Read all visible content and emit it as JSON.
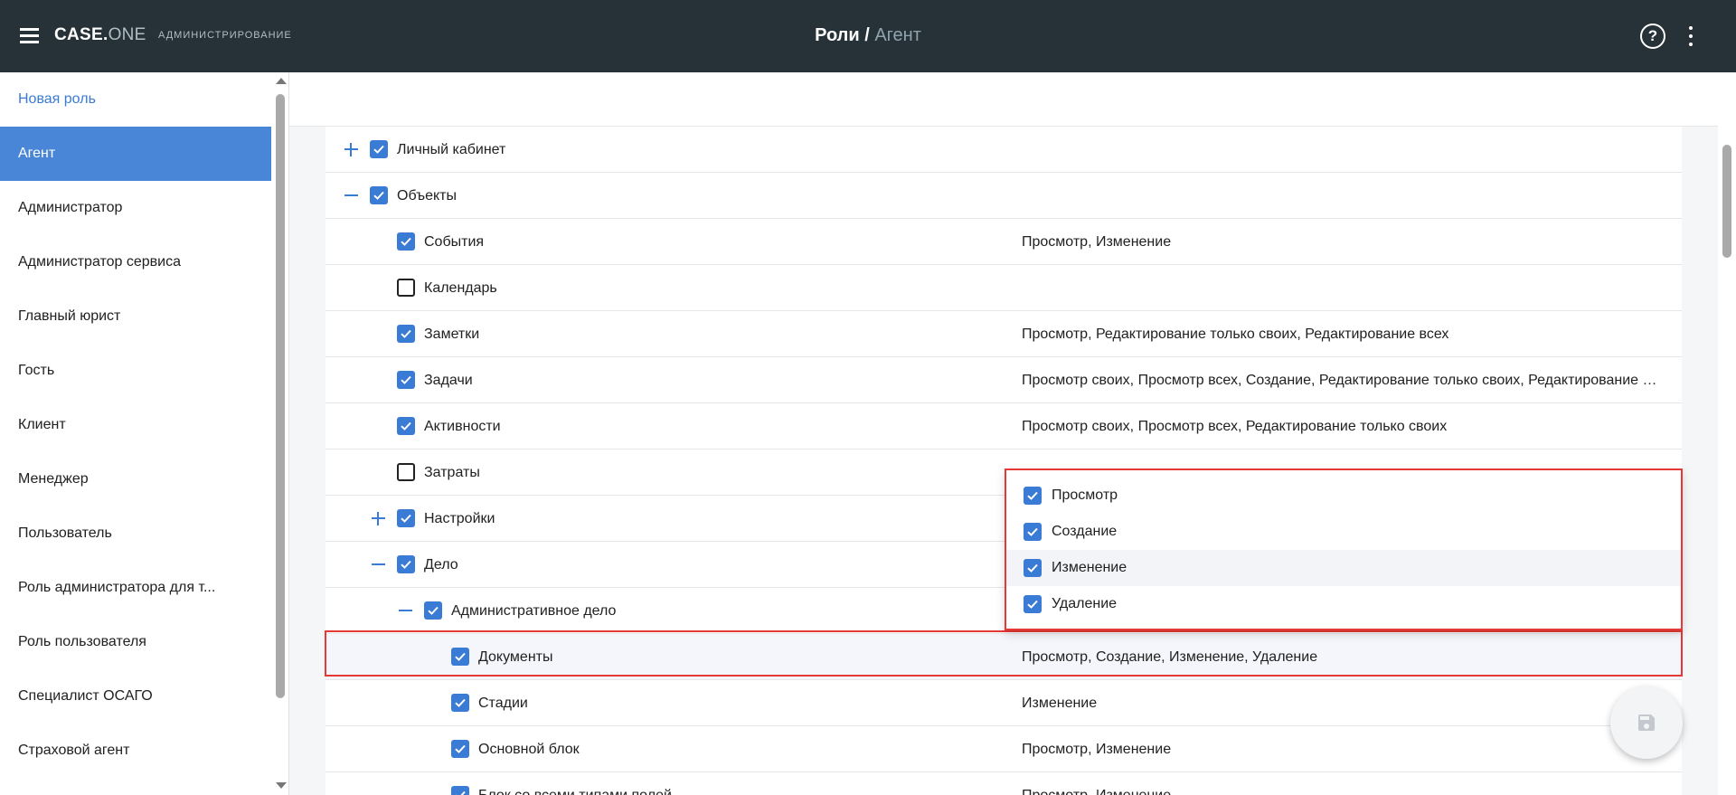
{
  "header": {
    "brand_main": "CASE.",
    "brand_accent": "ONE",
    "subtitle": "АДМИНИСТРИРОВАНИЕ",
    "breadcrumb_current": "Роли",
    "breadcrumb_separator": " / ",
    "breadcrumb_item": "Агент",
    "help_symbol": "?"
  },
  "sidebar": {
    "items": [
      {
        "label": "Новая роль"
      },
      {
        "label": "Агент"
      },
      {
        "label": "Администратор"
      },
      {
        "label": "Администратор сервиса"
      },
      {
        "label": "Главный юрист"
      },
      {
        "label": "Гость"
      },
      {
        "label": "Клиент"
      },
      {
        "label": "Менеджер"
      },
      {
        "label": "Пользователь"
      },
      {
        "label": "Роль администратора для т..."
      },
      {
        "label": "Роль пользователя"
      },
      {
        "label": "Специалист ОСАГО"
      },
      {
        "label": "Страховой агент"
      }
    ]
  },
  "tree": {
    "rows": [
      {
        "label": "Личный кабинет",
        "checked": true,
        "toggle": "expand",
        "perms": ""
      },
      {
        "label": "Объекты",
        "checked": true,
        "toggle": "collapse",
        "perms": ""
      },
      {
        "label": "События",
        "checked": true,
        "toggle": "",
        "perms": "Просмотр, Изменение"
      },
      {
        "label": "Календарь",
        "checked": false,
        "toggle": "",
        "perms": ""
      },
      {
        "label": "Заметки",
        "checked": true,
        "toggle": "",
        "perms": "Просмотр, Редактирование только своих, Редактирование всех"
      },
      {
        "label": "Задачи",
        "checked": true,
        "toggle": "",
        "perms": "Просмотр своих, Просмотр всех, Создание, Редактирование только своих, Редактирование всех"
      },
      {
        "label": "Активности",
        "checked": true,
        "toggle": "",
        "perms": "Просмотр своих, Просмотр всех, Редактирование только своих"
      },
      {
        "label": "Затраты",
        "checked": false,
        "toggle": "",
        "perms": ""
      },
      {
        "label": "Настройки",
        "checked": true,
        "toggle": "expand",
        "perms": ""
      },
      {
        "label": "Дело",
        "checked": true,
        "toggle": "collapse",
        "perms": ""
      },
      {
        "label": "Административное дело",
        "checked": true,
        "toggle": "collapse",
        "perms": ""
      },
      {
        "label": "Документы",
        "checked": true,
        "toggle": "",
        "perms": "Просмотр, Создание, Изменение, Удаление"
      },
      {
        "label": "Стадии",
        "checked": true,
        "toggle": "",
        "perms": "Изменение"
      },
      {
        "label": "Основной блок",
        "checked": true,
        "toggle": "",
        "perms": "Просмотр, Изменение"
      },
      {
        "label": "Блок со всеми типами полей",
        "checked": true,
        "toggle": "",
        "perms": "Просмотр, Изменение"
      }
    ]
  },
  "permission_dropdown": {
    "options": [
      {
        "label": "Просмотр",
        "checked": true
      },
      {
        "label": "Создание",
        "checked": true
      },
      {
        "label": "Изменение",
        "checked": true
      },
      {
        "label": "Удаление",
        "checked": true
      }
    ]
  },
  "colors": {
    "header_bg": "#263238",
    "accent": "#3a7bd5",
    "active_sidebar": "#4a86d8",
    "highlight_border": "#e53935"
  }
}
